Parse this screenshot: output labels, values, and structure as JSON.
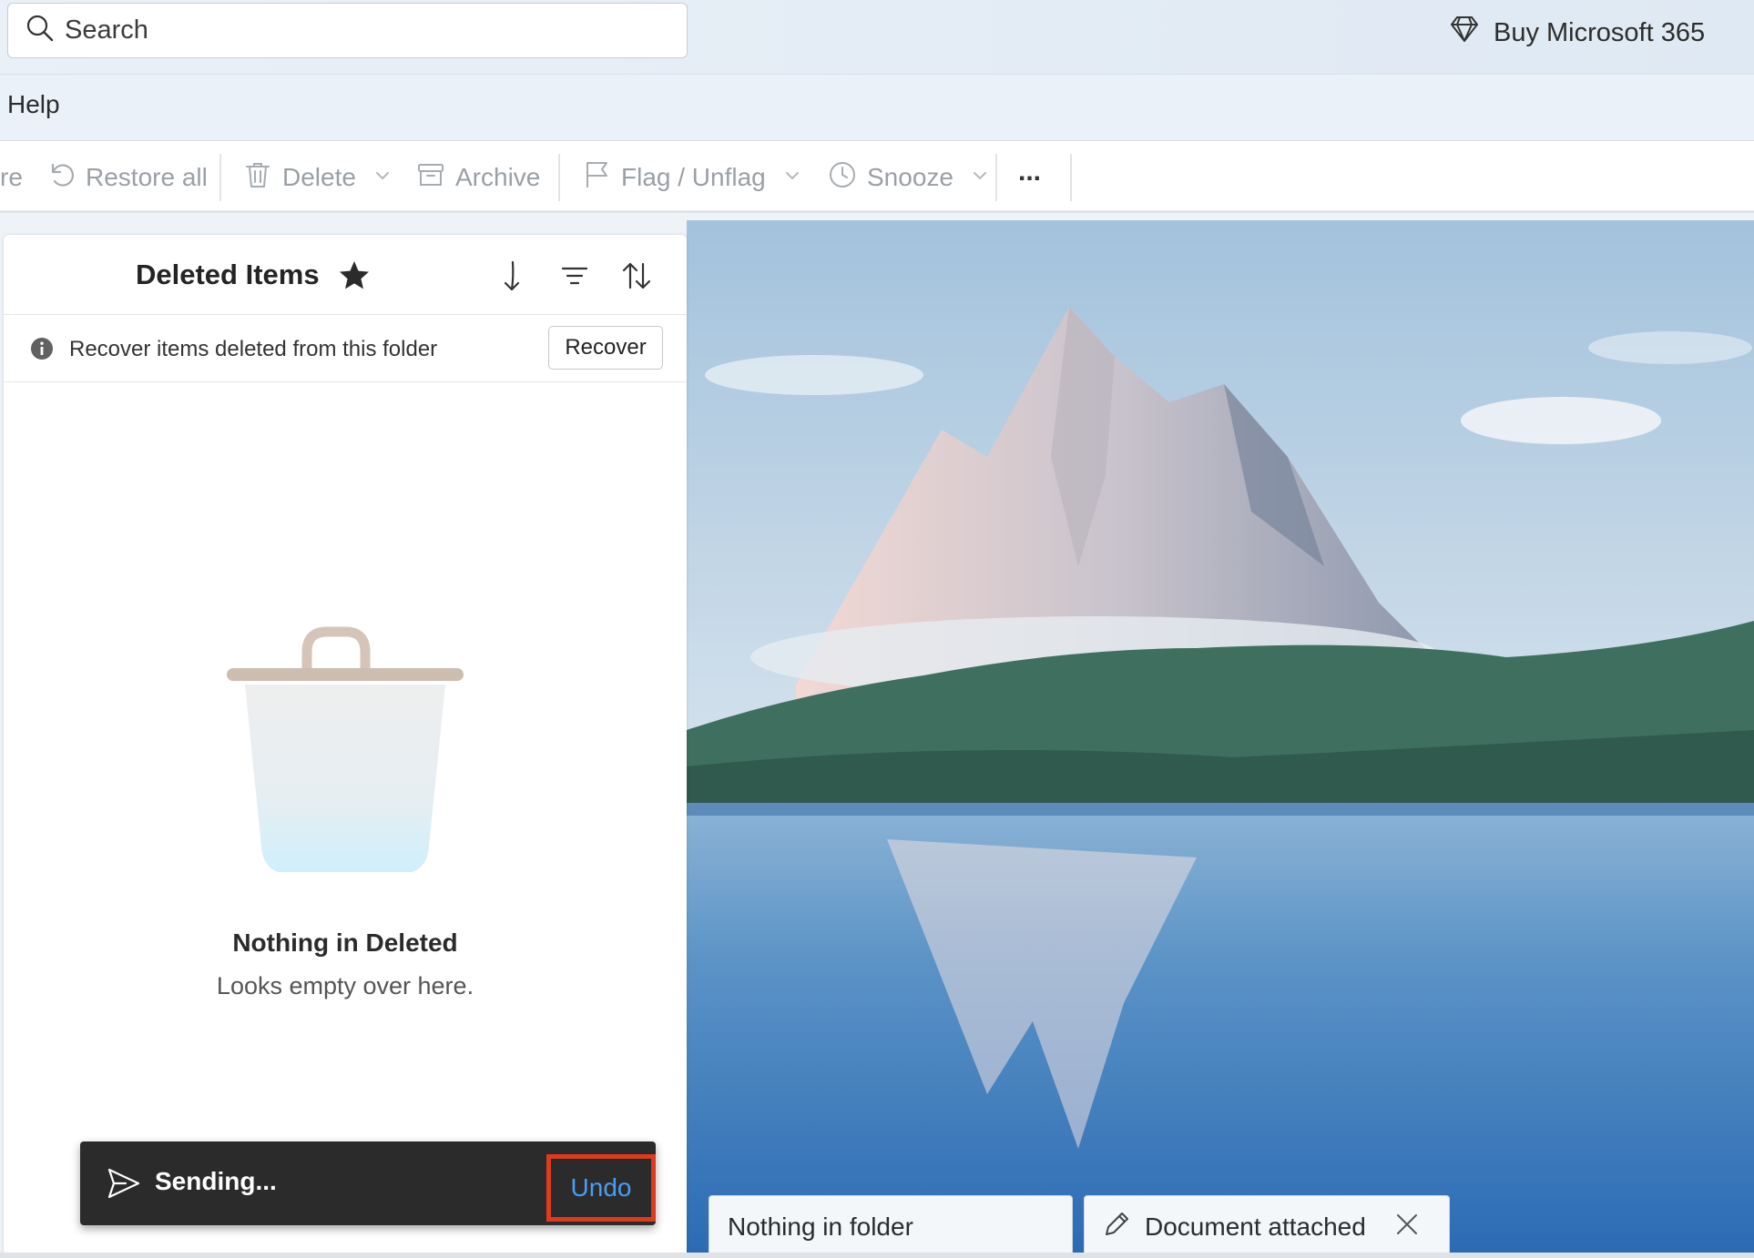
{
  "header": {
    "search_placeholder": "Search",
    "buy_label": "Buy Microsoft 365",
    "buy_icon": "diamond-icon"
  },
  "menu": {
    "help_label": "Help"
  },
  "toolbar": {
    "partial_label": "re",
    "restore_all_label": "Restore all",
    "delete_label": "Delete",
    "archive_label": "Archive",
    "flag_label": "Flag / Unflag",
    "snooze_label": "Snooze",
    "more_label": "..."
  },
  "folder": {
    "title": "Deleted Items",
    "recover_text": "Recover items deleted from this folder",
    "recover_button": "Recover",
    "empty_title": "Nothing in Deleted",
    "empty_subtitle": "Looks empty over here."
  },
  "toast": {
    "text": "Sending...",
    "undo_label": "Undo",
    "highlight_color": "#e03a1e"
  },
  "bottom_tabs": {
    "nothing_label": "Nothing in folder",
    "document_label": "Document attached"
  },
  "colors": {
    "accent": "#479ef5",
    "toast_bg": "#2b2b2b"
  }
}
